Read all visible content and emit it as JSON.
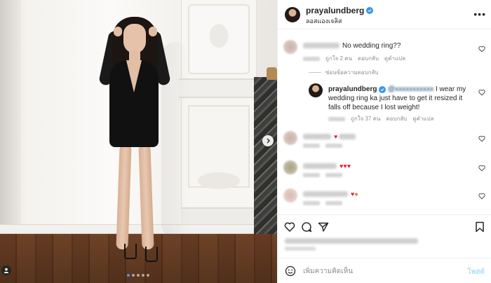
{
  "post": {
    "carousel_count": 5,
    "active_index": 0
  },
  "header": {
    "username": "prayalundberg",
    "location": "ลอสแองเจลิส",
    "more_icon": "more-horizontal-icon"
  },
  "comments": [
    {
      "text": "No wedding ring??",
      "likes": "ถูกใจ 2 คน",
      "reply": "ตอบกลับ",
      "translate": "ดูคำแปล"
    }
  ],
  "hide_replies_label": "ซ่อนข้อความตอบกลับ",
  "reply": {
    "username": "prayalundberg",
    "text": "I wear my wedding ring ka just have to get it resized it falls off because I lost weight!",
    "likes": "ถูกใจ 37 คน",
    "reply": "ตอบกลับ",
    "translate": "ดูคำแปล"
  },
  "colors": {
    "accent": "#3897f0",
    "heart": "#ed1c3a",
    "muted": "#8e8e8e"
  },
  "add_comment": {
    "placeholder": "เพิ่มความคิดเห็น",
    "post_label": "โพสต์"
  }
}
